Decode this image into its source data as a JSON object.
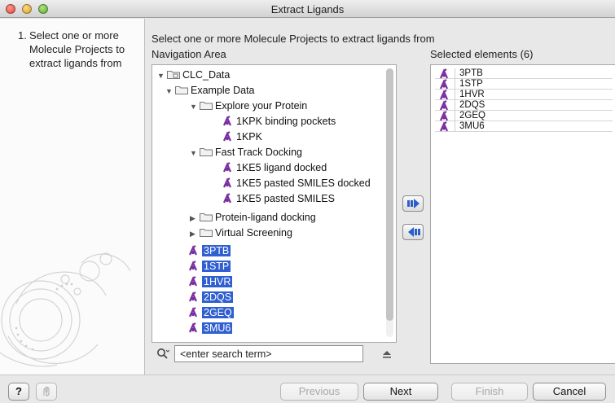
{
  "window": {
    "title": "Extract Ligands"
  },
  "steps": {
    "number": "1.",
    "label": "Select one or more Molecule Projects to extract ligands from"
  },
  "main": {
    "prompt": "Select one or more Molecule Projects to extract ligands from",
    "navigation_heading": "Navigation Area",
    "selected_heading": "Selected elements (6)"
  },
  "tree": {
    "root": "CLC_Data",
    "example_data": "Example Data",
    "explore_protein": "Explore your Protein",
    "kpk_pockets": "1KPK binding pockets",
    "kpk": "1KPK",
    "fast_track": "Fast Track Docking",
    "ke5_docked": "1KE5 ligand docked",
    "ke5_pasted_docked": "1KE5 pasted SMILES docked",
    "ke5_pasted": "1KE5 pasted SMILES",
    "protein_ligand": "Protein-ligand docking",
    "virtual_screening": "Virtual Screening",
    "items": [
      "3PTB",
      "1STP",
      "1HVR",
      "2DQS",
      "2GEQ",
      "3MU6"
    ]
  },
  "search": {
    "placeholder": "<enter search term>"
  },
  "selected": {
    "items": [
      "3PTB",
      "1STP",
      "1HVR",
      "2DQS",
      "2GEQ",
      "3MU6"
    ]
  },
  "buttons": {
    "help": "?",
    "previous": "Previous",
    "next": "Next",
    "finish": "Finish",
    "cancel": "Cancel"
  },
  "colors": {
    "selection": "#2f5fd0",
    "molecule_icon": "#7a2fa0",
    "arrow_icon": "#2a5fc9"
  }
}
